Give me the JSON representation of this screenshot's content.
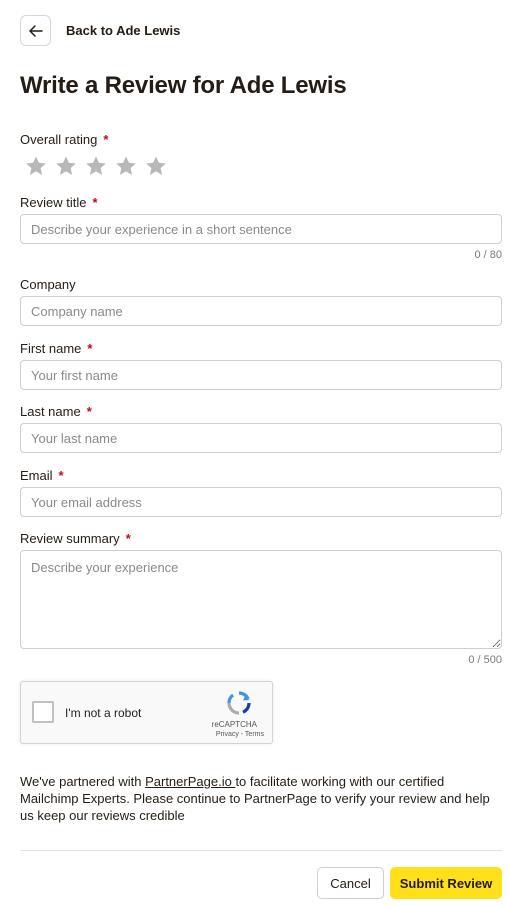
{
  "header": {
    "back_label": "Back to Ade Lewis",
    "title": "Write a Review for Ade Lewis"
  },
  "form": {
    "overall_rating": {
      "label": "Overall rating",
      "required_mark": "*",
      "value": 0,
      "max": 5,
      "star_color": "#b8b8b8"
    },
    "review_title": {
      "label": "Review title",
      "required_mark": "*",
      "placeholder": "Describe your experience in a short sentence",
      "value": "",
      "counter": "0 / 80"
    },
    "company": {
      "label": "Company",
      "placeholder": "Company name",
      "value": ""
    },
    "first_name": {
      "label": "First name",
      "required_mark": "*",
      "placeholder": "Your first name",
      "value": ""
    },
    "last_name": {
      "label": "Last name",
      "required_mark": "*",
      "placeholder": "Your last name",
      "value": ""
    },
    "email": {
      "label": "Email",
      "required_mark": "*",
      "placeholder": "Your email address",
      "value": ""
    },
    "review_summary": {
      "label": "Review summary",
      "required_mark": "*",
      "placeholder": "Describe your experience",
      "value": "",
      "counter": "0 / 500"
    }
  },
  "captcha": {
    "label": "I'm not a robot",
    "brand": "reCAPTCHA",
    "links": "Privacy - Terms"
  },
  "notice": {
    "prefix": "We've partnered with ",
    "link_text": "PartnerPage.io ",
    "suffix": "to facilitate working with our certified Mailchimp Experts. Please continue to PartnerPage to verify your review and help us keep our reviews credible"
  },
  "footer": {
    "cancel_label": "Cancel",
    "submit_label": "Submit Review"
  },
  "colors": {
    "accent": "#ffe01b",
    "required": "#d0021b",
    "text": "#241c15"
  }
}
